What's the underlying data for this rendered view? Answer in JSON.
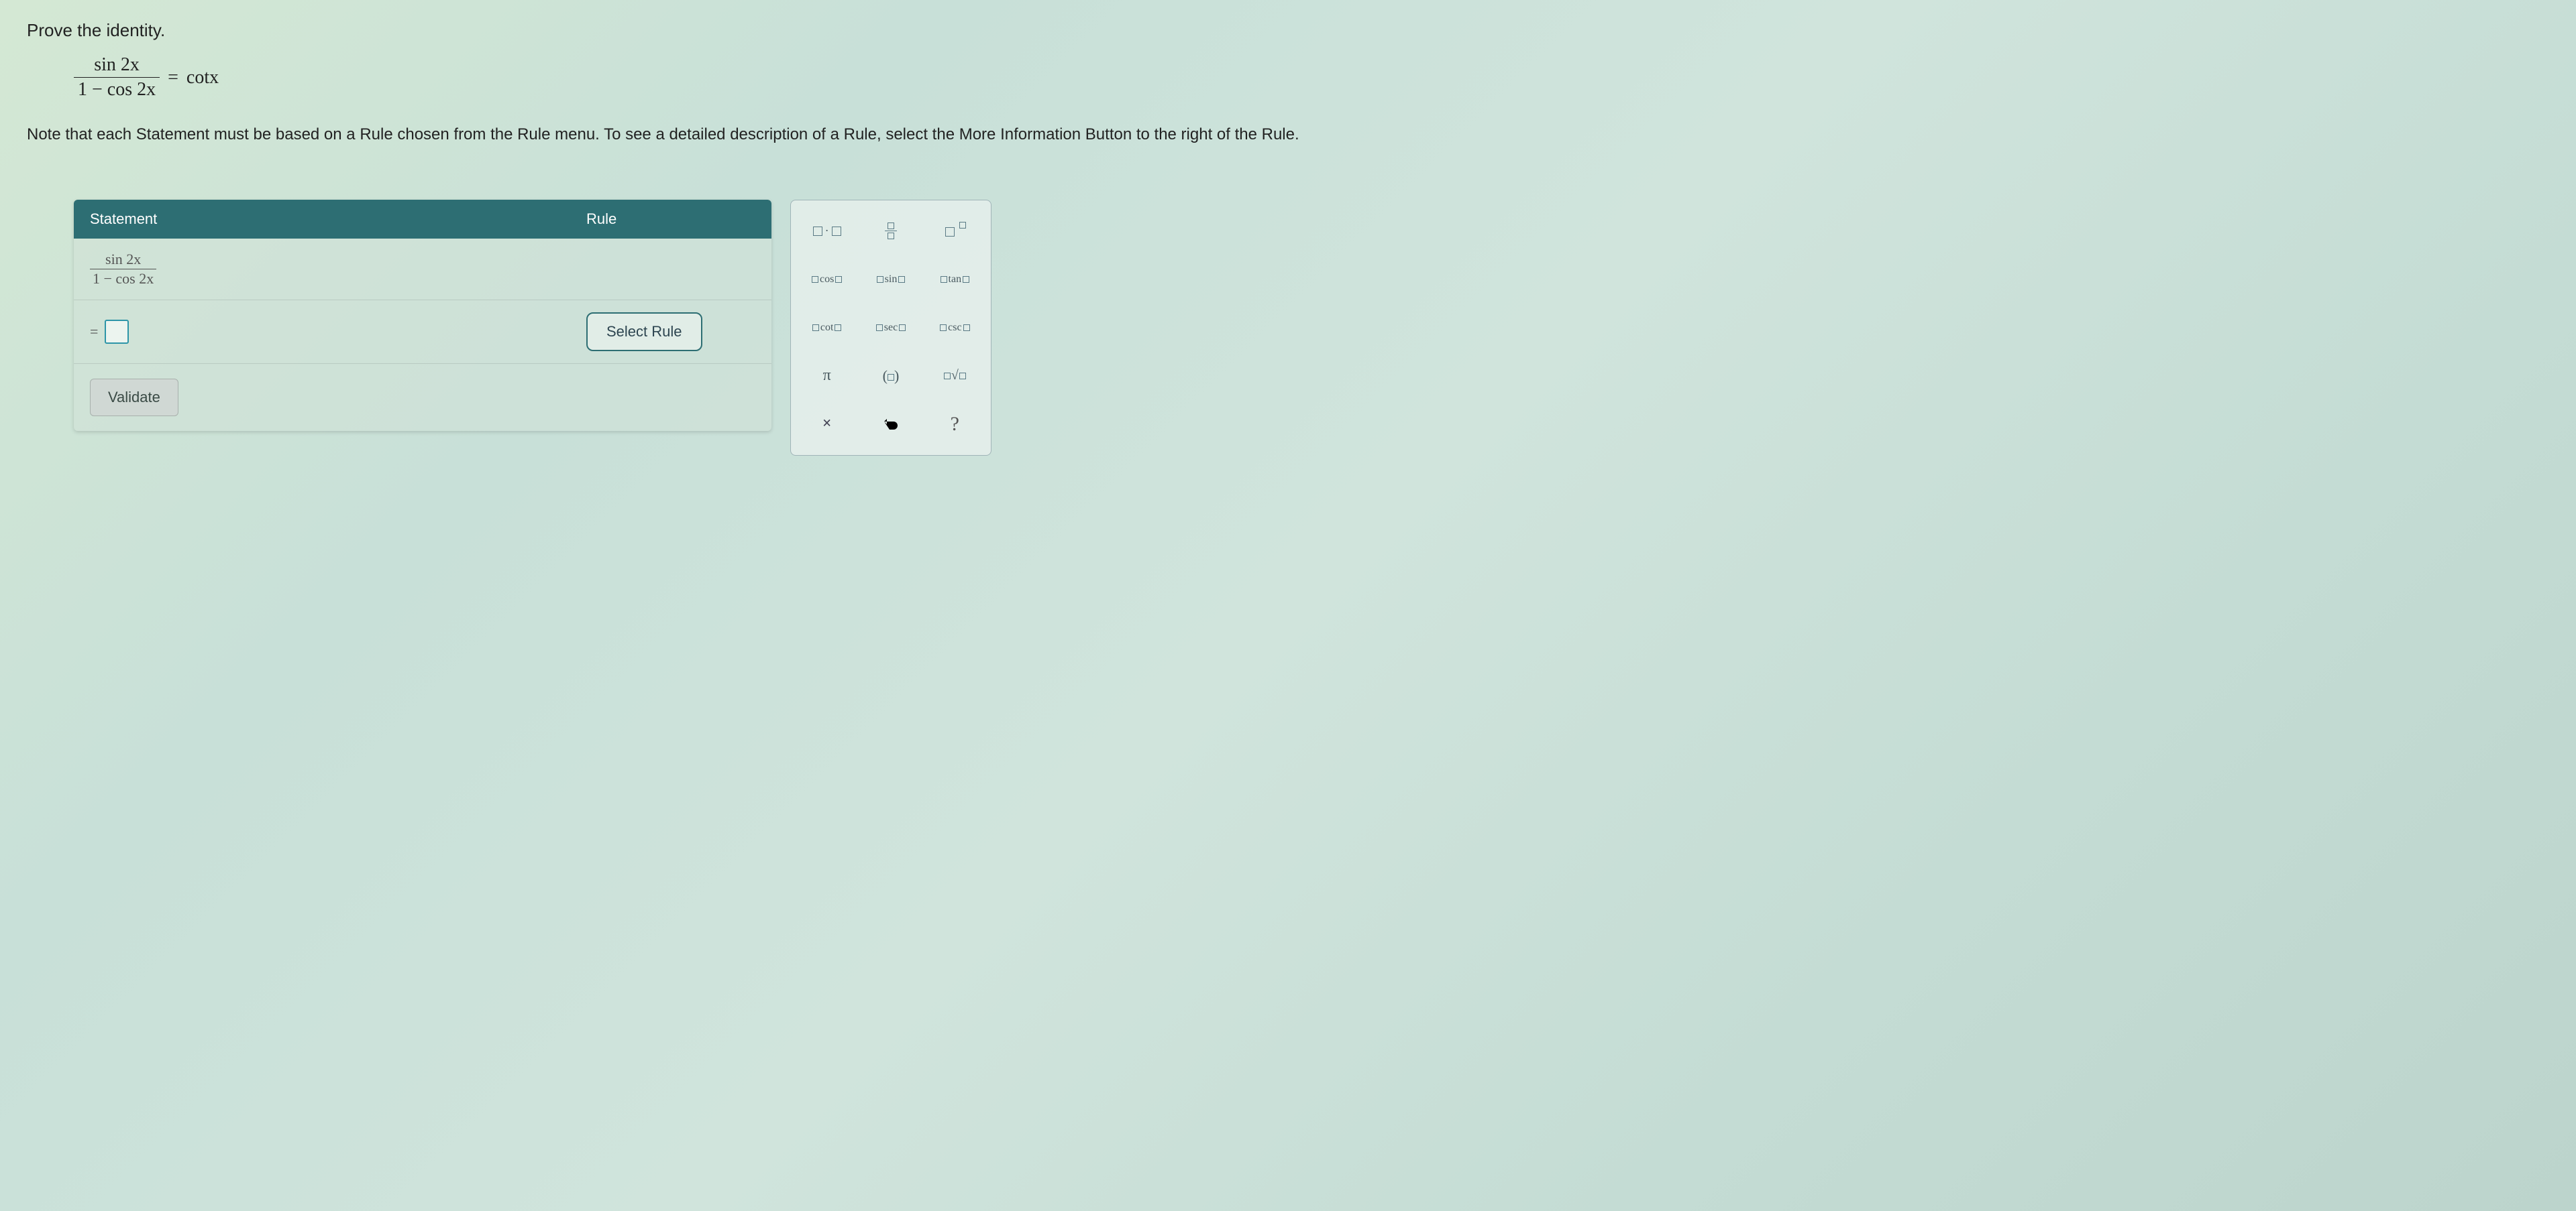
{
  "instructions": {
    "title": "Prove the identity.",
    "equation": {
      "numerator": "sin 2x",
      "denominator": "1 − cos 2x",
      "equals": "=",
      "rhs": "cotx"
    },
    "note": "Note that each Statement must be based on a Rule chosen from the Rule menu. To see a detailed description of a Rule, select the More Information Button to the right of the Rule."
  },
  "panel": {
    "header": {
      "statement": "Statement",
      "rule": "Rule"
    },
    "row1": {
      "numerator": "sin 2x",
      "denominator": "1 − cos 2x"
    },
    "row2": {
      "prefix": "=",
      "select_rule": "Select Rule"
    },
    "validate": "Validate"
  },
  "palette": {
    "cos": "cos",
    "sin": "sin",
    "tan": "tan",
    "cot": "cot",
    "sec": "sec",
    "csc": "csc",
    "pi": "π",
    "help": "?"
  }
}
